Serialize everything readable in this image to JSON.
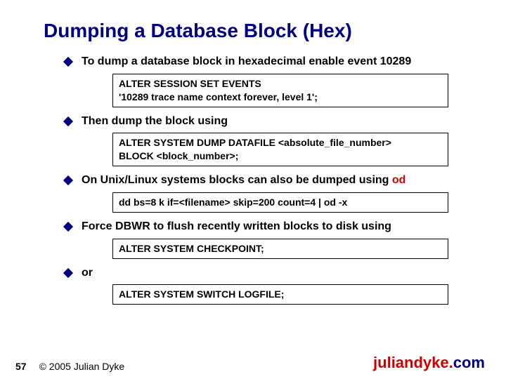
{
  "title": "Dumping a Database Block (Hex)",
  "bullets": {
    "b1": "To dump a database block in hexadecimal enable event 10289",
    "b2": "Then dump the block using",
    "b3_pre": "On Unix/Linux systems blocks can also be dumped using ",
    "b3_od": "od",
    "b4": "Force DBWR to flush recently written blocks to disk using",
    "b5": "or"
  },
  "code": {
    "c1": "ALTER SESSION SET EVENTS\n'10289 trace name context forever, level 1';",
    "c2": "ALTER SYSTEM DUMP DATAFILE <absolute_file_number>\nBLOCK <block_number>;",
    "c3": "dd bs=8 k if=<filename> skip=200 count=4 | od -x",
    "c4": "ALTER SYSTEM CHECKPOINT;",
    "c5": "ALTER SYSTEM SWITCH LOGFILE;"
  },
  "footer": {
    "page": "57",
    "copyright": "© 2005 Julian Dyke",
    "site_left": "juliandyke.",
    "site_right": "com"
  }
}
